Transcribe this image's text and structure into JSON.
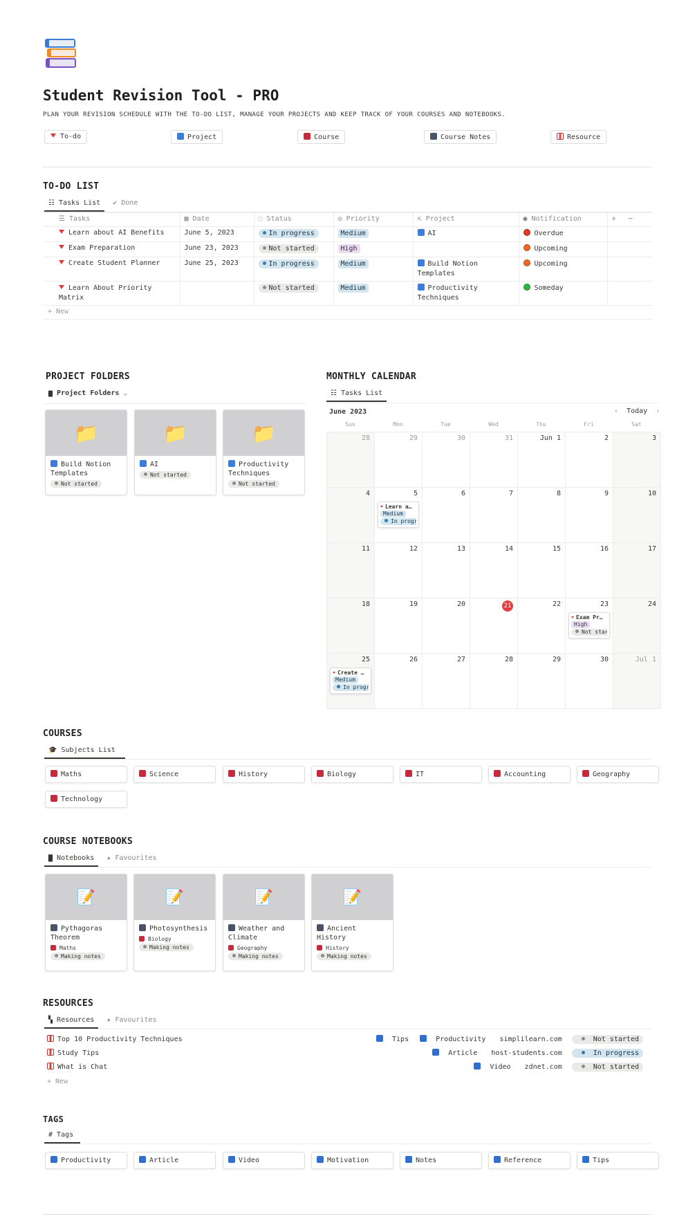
{
  "page": {
    "title": "Student Revision Tool - PRO",
    "subtitle": "PLAN YOUR REVISION SCHEDULE WITH THE TO-DO LIST, MANAGE YOUR PROJECTS AND KEEP TRACK OF YOUR COURSES AND NOTEBOOKS."
  },
  "quick_links": [
    "To-do",
    "Project",
    "Course",
    "Course Notes",
    "Resource"
  ],
  "todo": {
    "heading": "TO-DO LIST",
    "tabs": [
      "Tasks List",
      "Done"
    ],
    "columns": [
      "Tasks",
      "Date",
      "Status",
      "Priority",
      "Project",
      "Notification"
    ],
    "rows": [
      {
        "task": "Learn about AI Benefits",
        "date": "June 5, 2023",
        "status": "In progress",
        "priority": "Medium",
        "project": "AI",
        "notification": "Overdue",
        "notif_color": "#e03b24"
      },
      {
        "task": "Exam Preparation",
        "date": "June 23, 2023",
        "status": "Not started",
        "priority": "High",
        "project": "",
        "notification": "Upcoming",
        "notif_color": "#f06a26"
      },
      {
        "task": "Create Student Planner",
        "date": "June 25, 2023",
        "status": "In progress",
        "priority": "Medium",
        "project": "Build Notion Templates",
        "notification": "Upcoming",
        "notif_color": "#f06a26"
      },
      {
        "task": "Learn About Priority Matrix",
        "date": "",
        "status": "Not started",
        "priority": "Medium",
        "project": "Productivity Techniques",
        "notification": "Someday",
        "notif_color": "#2db83d"
      }
    ],
    "new_label": "+ New"
  },
  "projects": {
    "heading": "PROJECT FOLDERS",
    "view_label": "Project Folders",
    "cards": [
      {
        "title": "Build Notion Templates",
        "status": "Not started"
      },
      {
        "title": "AI",
        "status": "Not started"
      },
      {
        "title": "Productivity Techniques",
        "status": "Not started"
      }
    ]
  },
  "calendar": {
    "heading": "MONTHLY CALENDAR",
    "tab": "Tasks List",
    "month": "June 2023",
    "today_label": "Today",
    "weekdays": [
      "Sun",
      "Mon",
      "Tue",
      "Wed",
      "Thu",
      "Fri",
      "Sat"
    ],
    "weeks": [
      [
        "28",
        "29",
        "30",
        "31",
        "Jun 1",
        "2",
        "3"
      ],
      [
        "4",
        "5",
        "6",
        "7",
        "8",
        "9",
        "10"
      ],
      [
        "11",
        "12",
        "13",
        "14",
        "15",
        "16",
        "17"
      ],
      [
        "18",
        "19",
        "20",
        "21",
        "22",
        "23",
        "24"
      ],
      [
        "25",
        "26",
        "27",
        "28",
        "29",
        "30",
        "Jul 1"
      ]
    ],
    "today": "21",
    "events": [
      {
        "title": "Learn a…",
        "priority": "Medium",
        "status": "In progress"
      },
      {
        "title": "Exam Pr…",
        "priority": "High",
        "status": "Not started"
      },
      {
        "title": "Create …",
        "priority": "Medium",
        "status": "In progress"
      }
    ]
  },
  "courses": {
    "heading": "COURSES",
    "tab": "Subjects List",
    "items": [
      "Maths",
      "Science",
      "History",
      "Biology",
      "IT",
      "Accounting",
      "Geography",
      "Technology"
    ]
  },
  "notebooks": {
    "heading": "COURSE NOTEBOOKS",
    "tabs": [
      "Notebooks",
      "Favourites"
    ],
    "cards": [
      {
        "title": "Pythagoras Theorem",
        "course": "Maths",
        "status": "Making notes"
      },
      {
        "title": "Photosynthesis",
        "course": "Biology",
        "status": "Making notes"
      },
      {
        "title": "Weather and Climate",
        "course": "Geography",
        "status": "Making notes"
      },
      {
        "title": "Ancient History",
        "course": "History",
        "status": "Making notes"
      }
    ]
  },
  "resources": {
    "heading": "RESOURCES",
    "tabs": [
      "Resources",
      "Favourites"
    ],
    "rows": [
      {
        "title": "Top 10 Productivity Techniques",
        "tags": [
          "Tips",
          "Productivity"
        ],
        "site": "simplilearn.com",
        "status": "Not started"
      },
      {
        "title": "Study Tips",
        "tags": [
          "Article"
        ],
        "site": "host-students.com",
        "status": "In progress"
      },
      {
        "title": "What is Chat",
        "tags": [
          "Video"
        ],
        "site": "zdnet.com",
        "status": "Not started"
      }
    ],
    "new_label": "+ New"
  },
  "tags": {
    "heading": "TAGS",
    "tab": "Tags",
    "items": [
      "Productivity",
      "Article",
      "Video",
      "Motivation",
      "Notes",
      "Reference",
      "Tips"
    ]
  }
}
